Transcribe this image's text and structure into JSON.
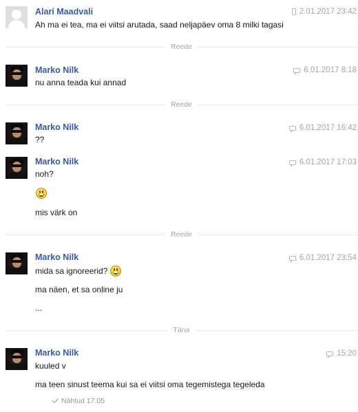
{
  "messages": [
    {
      "sender": "Alari Maadvali",
      "time": "2.01.2017 23:42",
      "source_icon": "mobile-phone-icon",
      "lines": [
        "Ah ma ei tea, ma ei viitsi arutada, saad neljapäev oma 8 milki tagasi"
      ]
    },
    {
      "sender": "Marko Nilk",
      "time": "6.01.2017 8:18",
      "source_icon": "chat-bubble-icon",
      "lines": [
        "nu anna teada kui annad"
      ]
    },
    {
      "sender": "Marko Nilk",
      "time": "6.01.2017 16:42",
      "source_icon": "chat-bubble-icon",
      "lines": [
        "??"
      ]
    },
    {
      "sender": "Marko Nilk",
      "time": "6.01.2017 17:03",
      "source_icon": "chat-bubble-icon",
      "lines": [
        "noh?",
        "mis värk on"
      ]
    },
    {
      "sender": "Marko Nilk",
      "time": "6.01.2017 23:54",
      "source_icon": "chat-bubble-icon",
      "lines": [
        "mida sa ignoreerid?",
        "ma näen, et sa online ju",
        "..."
      ]
    },
    {
      "sender": "Marko Nilk",
      "time": "15:20",
      "source_icon": "chat-bubble-icon",
      "lines": [
        "kuuled v",
        "ma teen sinust teema kui sa ei viitsi oma tegemistega tegeleda"
      ]
    }
  ],
  "dividers": [
    "Reede",
    "Reede",
    "Reede",
    "Täna"
  ],
  "seen_status": "Nähtud 17:05",
  "colors": {
    "sender_name": "#3b5998",
    "meta_gray": "#a0a4ad",
    "divider_line": "#e5e6e9"
  }
}
